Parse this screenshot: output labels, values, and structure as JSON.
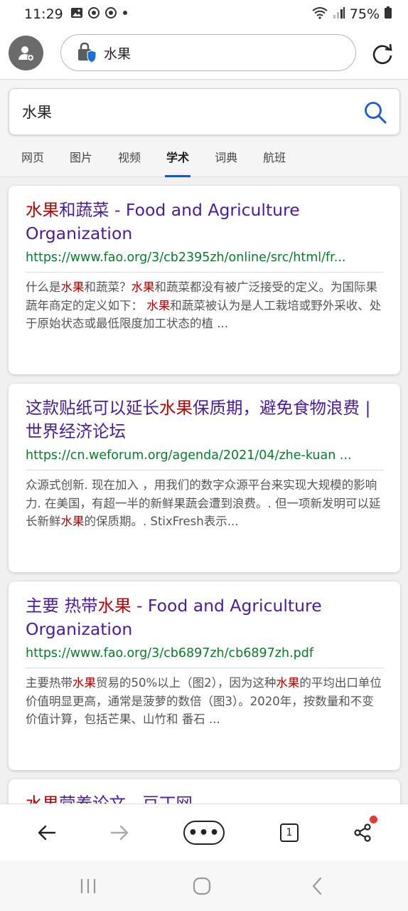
{
  "status_bar": {
    "time": "11:29",
    "battery": "75%",
    "icons": [
      "gallery-icon",
      "sync-icon",
      "sync-icon",
      "dot-icon",
      "wifi-icon",
      "signal-icon",
      "battery-icon"
    ]
  },
  "browser": {
    "address_text": "水果",
    "avatar_icon": "add-user-icon",
    "reload_icon": "reload-icon"
  },
  "search": {
    "query": "水果",
    "tabs": [
      {
        "label": "网页",
        "active": false
      },
      {
        "label": "图片",
        "active": false
      },
      {
        "label": "视频",
        "active": false
      },
      {
        "label": "学术",
        "active": true
      },
      {
        "label": "词典",
        "active": false
      },
      {
        "label": "航班",
        "active": false
      }
    ]
  },
  "results": [
    {
      "title_hl": "水果",
      "title_rest": "和蔬菜 - Food and Agriculture Organization",
      "url": "https://www.fao.org/3/cb2395zh/online/src/html/fr...",
      "snippet": [
        {
          "t": "什么是",
          "hl": false
        },
        {
          "t": "水果",
          "hl": true
        },
        {
          "t": "和蔬菜？",
          "hl": false
        },
        {
          "t": "水果",
          "hl": true
        },
        {
          "t": "和蔬菜都没有被广泛接受的定义。为国际果蔬年商定的定义如下： ",
          "hl": false
        },
        {
          "t": "水果",
          "hl": true
        },
        {
          "t": "和蔬菜被认为是人工栽培或野外采收、处于原始状态或最低限度加工状态的植 ...",
          "hl": false
        }
      ]
    },
    {
      "title_pre": "这款贴纸可以延长",
      "title_hl": "水果",
      "title_rest": "保质期，避免食物浪费 | 世界经济论坛",
      "url": "https://cn.weforum.org/agenda/2021/04/zhe-kuan ...",
      "snippet": [
        {
          "t": "众源式创新. 现在加入 ，用我们的数字众源平台来实现大规模的影响力. 在美国，有超一半的新鲜果蔬会遭到浪费。. 但一项新发明可以延长新鲜",
          "hl": false
        },
        {
          "t": "水果",
          "hl": true
        },
        {
          "t": "的保质期。. StixFresh表示...",
          "hl": false
        }
      ]
    },
    {
      "title_pre": "主要 热带",
      "title_hl": "水果",
      "title_rest": " - Food and Agriculture Organization",
      "url": "https://www.fao.org/3/cb6897zh/cb6897zh.pdf",
      "snippet": [
        {
          "t": "主要热带",
          "hl": false
        },
        {
          "t": "水果",
          "hl": true
        },
        {
          "t": "贸易的50%以上（图2），因为这种",
          "hl": false
        },
        {
          "t": "水果",
          "hl": true
        },
        {
          "t": "的平均出口单位价值明显更高，通常是菠萝的数倍（图3）。2020年，按数量和不变价值计算，包括芒果、山竹和 番石 ...",
          "hl": false
        }
      ]
    },
    {
      "title_hl": "水果",
      "title_rest": "营养论文 - 豆丁网"
    }
  ],
  "bottom_bar": {
    "more_label": "•••",
    "tab_count": "1",
    "icons": [
      "back-arrow-icon",
      "forward-arrow-icon",
      "more-icon",
      "tabs-icon",
      "share-icon"
    ]
  },
  "colors": {
    "title": "#4b1c9a",
    "highlight": "#b30000",
    "url": "#0b7a2b",
    "tab_indicator": "#1a56c4"
  }
}
